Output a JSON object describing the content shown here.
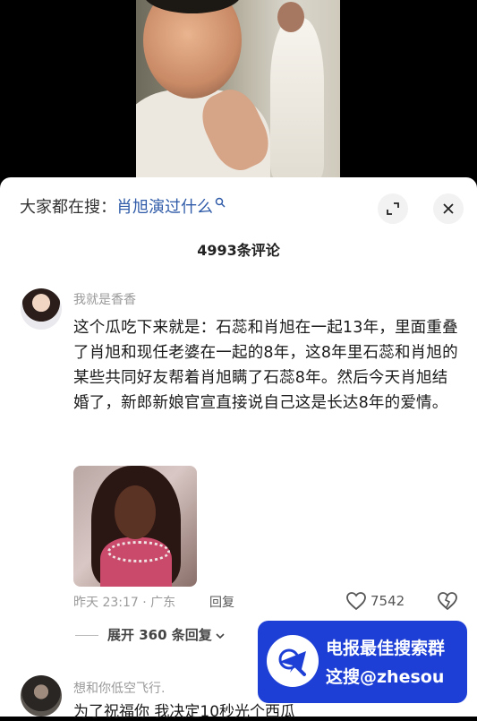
{
  "search": {
    "prefix": "大家都在搜：",
    "query": "肖旭演过什么"
  },
  "comments_header": {
    "count_label": "4993条评论"
  },
  "comments": [
    {
      "username": "我就是香香",
      "text": "这个瓜吃下来就是：石蕊和肖旭在一起13年，里面重叠了肖旭和现任老婆在一起的8年，这8年里石蕊和肖旭的某些共同好友帮着肖旭瞒了石蕊8年。然后今天肖旭结婚了，新郎新娘官宣直接说自己这是长达8年的爱情。",
      "meta": "昨天 23:17 · 广东",
      "reply_label": "回复",
      "like_count": "7542",
      "expand_replies": "展开 360 条回复"
    },
    {
      "username": "想和你低空飞行.",
      "text": "为了祝福你 我决定10秒光个西瓜"
    }
  ],
  "banner": {
    "line1": "电报最佳搜索群",
    "line2": "这搜@zhesou"
  },
  "icons": {
    "expand": "expand-icon",
    "close": "close-icon",
    "like": "heart-icon",
    "dislike": "broken-heart-icon",
    "search": "search-icon"
  },
  "colors": {
    "link": "#2f5ba8",
    "banner_bg": "#1d3fd6",
    "muted": "#9a9a9a"
  }
}
